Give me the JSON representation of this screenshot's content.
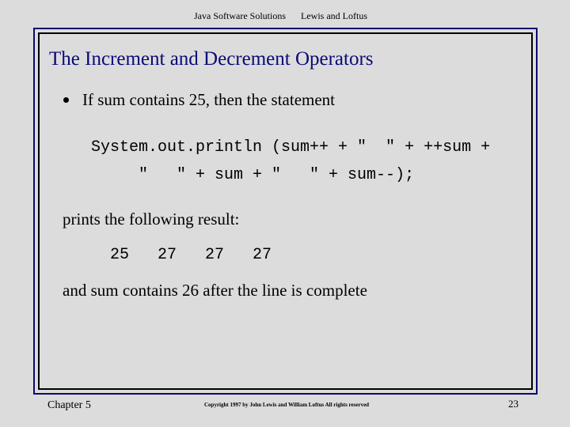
{
  "header": {
    "book_title": "Java Software Solutions",
    "authors": "Lewis and Loftus"
  },
  "slide": {
    "title": "The Increment and Decrement Operators",
    "bullet": "If sum contains 25, then the statement",
    "code_lines": [
      "System.out.println (sum++ + \"  \" + ++sum +",
      "     \"   \" + sum + \"   \" + sum--);"
    ],
    "intro_result": "prints the following result:",
    "result_output": "25   27   27   27",
    "conclusion": "and sum contains 26 after the line is complete"
  },
  "footer": {
    "chapter": "Chapter 5",
    "copyright": "Copyright 1997 by John Lewis and William Loftus  All rights reserved",
    "page_number": "23"
  },
  "colors": {
    "background": "#dcdcdc",
    "title": "#0a0a78",
    "outer_border": "#0a0a6e",
    "inner_border": "#000000"
  }
}
